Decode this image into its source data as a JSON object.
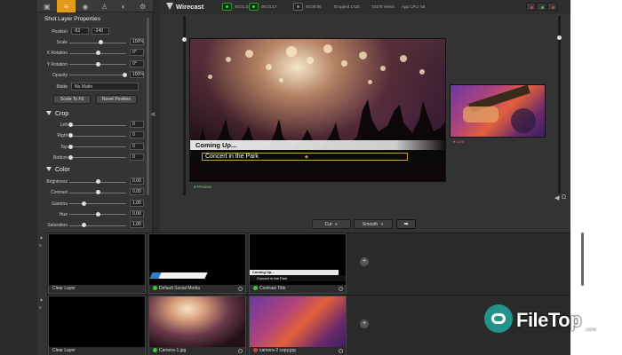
{
  "app": {
    "title": "Wirecast"
  },
  "status_bar": {
    "stream_time": "00:01:31",
    "record_time": "00:01:17",
    "iso_time": "00:00:00",
    "dropped": "Dropped 1733",
    "views": "72478 Views",
    "app_cpu": "App CPU: 58"
  },
  "inspector": {
    "tabs": [
      "audio-tab",
      "layer-properties-tab",
      "speaker-tab",
      "user-tab",
      "color-tab",
      "settings-tab"
    ],
    "active_tab": 1,
    "title": "Shot Layer Properties",
    "position": {
      "label": "Position",
      "x": "-62",
      "y": "-240"
    },
    "sliders": [
      {
        "label": "Scale",
        "value": "100%",
        "frac": 0.55
      },
      {
        "label": "X Rotation",
        "value": "0°",
        "frac": 0.5
      },
      {
        "label": "Y Rotation",
        "value": "0°",
        "frac": 0.5
      },
      {
        "label": "Opacity",
        "value": "100%",
        "frac": 0.98
      }
    ],
    "matte": {
      "label": "Matte",
      "value": "No Matte"
    },
    "scale_to_fit": "Scale To Fit",
    "reset_position": "Reset Position",
    "crop": {
      "title": "Crop",
      "rows": [
        {
          "label": "Left",
          "value": "0"
        },
        {
          "label": "Right",
          "value": "0"
        },
        {
          "label": "Top",
          "value": "0"
        },
        {
          "label": "Bottom",
          "value": "0"
        }
      ]
    },
    "color": {
      "title": "Color",
      "rows": [
        {
          "label": "Brightness",
          "value": "0.00",
          "frac": 0.5
        },
        {
          "label": "Contrast",
          "value": "0.00",
          "frac": 0.5
        },
        {
          "label": "Gamma",
          "value": "1.00",
          "frac": 0.25
        },
        {
          "label": "Hue",
          "value": "0.00",
          "frac": 0.5
        },
        {
          "label": "Saturation",
          "value": "1.00",
          "frac": 0.25
        }
      ]
    }
  },
  "preview": {
    "coming_up": "Coming Up...",
    "lower_third": "Concert in the Park",
    "label": "Preview",
    "live_label": "Live"
  },
  "transition": {
    "cut": "Cut",
    "smooth": "Smooth",
    "go": "➡"
  },
  "shots_row1": [
    {
      "caption": "Clear Layer",
      "type": "black"
    },
    {
      "caption": "Default Social Media",
      "type": "social",
      "status": "ok"
    },
    {
      "caption": "Contrast Title",
      "type": "title",
      "status": "ok",
      "mini_title": "Coming Up...",
      "mini_sub": "Concert in the Park"
    }
  ],
  "shots_row2": [
    {
      "caption": "Clear Layer",
      "type": "black"
    },
    {
      "caption": "Camera-1.jpg",
      "type": "cam1",
      "status": "ok"
    },
    {
      "caption": "camera-2 copy.jpg",
      "type": "cam2",
      "status": "rd"
    }
  ],
  "watermark": {
    "text": "FileTop",
    "sub": ".com"
  },
  "colors": {
    "accent": "#e49b1b",
    "live_red": "#e25a5a",
    "preview_green": "#7cc77c"
  }
}
